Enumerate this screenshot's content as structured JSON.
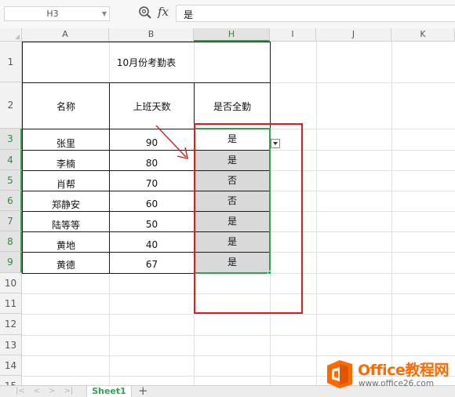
{
  "formula_bar": {
    "name_box": "H3",
    "fx_label": "fx",
    "formula": "是"
  },
  "columns": [
    "A",
    "B",
    "H",
    "I",
    "J",
    "K"
  ],
  "rows": [
    "1",
    "2",
    "3",
    "4",
    "5",
    "6",
    "7",
    "8",
    "9",
    "10",
    "11",
    "12",
    "13",
    "14",
    "15"
  ],
  "table": {
    "title": "10月份考勤表",
    "headers": [
      "名称",
      "上班天数",
      "是否全勤"
    ],
    "records": [
      {
        "name": "张里",
        "days": "90",
        "full": "是"
      },
      {
        "name": "李楠",
        "days": "80",
        "full": "是"
      },
      {
        "name": "肖帮",
        "days": "70",
        "full": "否"
      },
      {
        "name": "郑静安",
        "days": "60",
        "full": "否"
      },
      {
        "name": "陆等等",
        "days": "50",
        "full": "是"
      },
      {
        "name": "黄地",
        "days": "40",
        "full": "是"
      },
      {
        "name": "黄德",
        "days": "67",
        "full": "是"
      }
    ]
  },
  "sheets": {
    "nav": [
      "|<",
      "<",
      ">",
      ">|"
    ],
    "tabs": [
      "Sheet1"
    ],
    "add": "+"
  },
  "watermark": {
    "title": "Office教程网",
    "url": "www.office26.com"
  },
  "colors": {
    "selection": "#2fa34a",
    "annotation": "#e0191f",
    "watermark": "#ff6a00"
  }
}
